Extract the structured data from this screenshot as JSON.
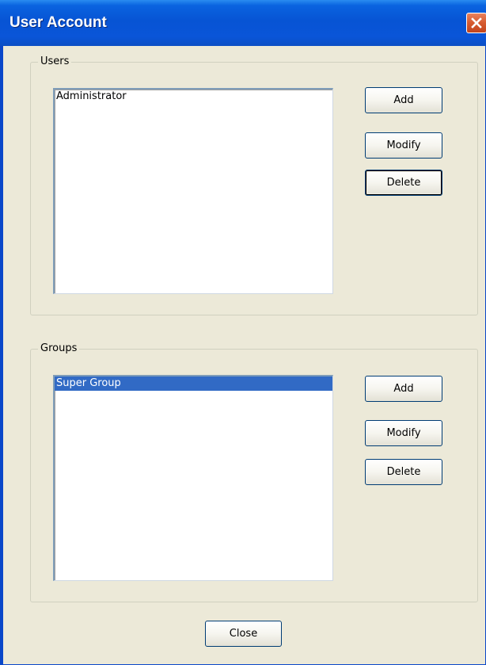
{
  "window": {
    "title": "User Account",
    "close_icon": "close-icon",
    "title_color": "#0a55d8",
    "close_color": "#d65a2f"
  },
  "users": {
    "legend": "Users",
    "items": [
      "Administrator"
    ],
    "buttons": {
      "add": "Add",
      "modify": "Modify",
      "delete": "Delete"
    }
  },
  "groups": {
    "legend": "Groups",
    "items": [
      "Super Group"
    ],
    "selected_item": "Super Group",
    "selection_color": "#316ac5",
    "buttons": {
      "add": "Add",
      "modify": "Modify",
      "delete": "Delete"
    }
  },
  "footer": {
    "close_label": "Close"
  }
}
